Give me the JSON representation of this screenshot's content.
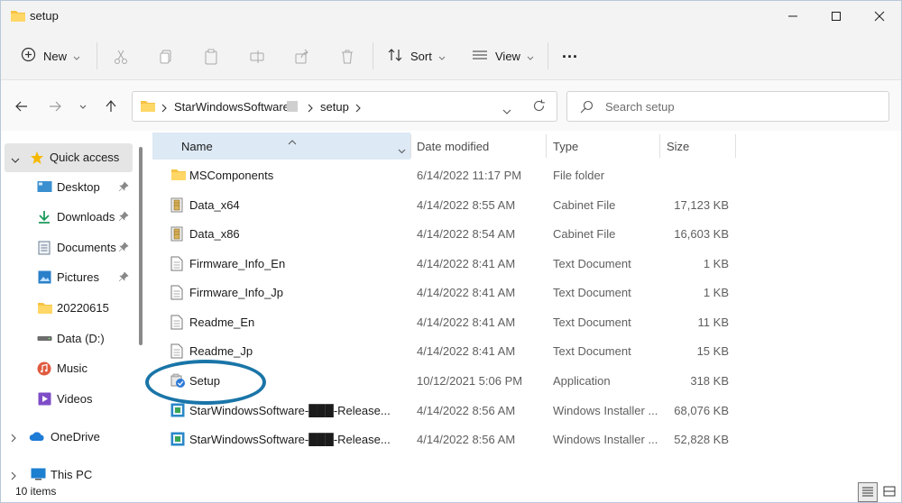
{
  "window": {
    "title": "setup"
  },
  "toolbar": {
    "new_label": "New",
    "sort_label": "Sort",
    "view_label": "View",
    "more_label": "..."
  },
  "address": {
    "segments": [
      "StarWindowsSoftware",
      "setup"
    ],
    "search_placeholder": "Search setup"
  },
  "nav": {
    "items": [
      {
        "label": "Quick access",
        "icon": "star-icon"
      },
      {
        "label": "Desktop",
        "icon": "desktop-icon",
        "pinned": true
      },
      {
        "label": "Downloads",
        "icon": "download-icon",
        "pinned": true
      },
      {
        "label": "Documents",
        "icon": "document-icon",
        "pinned": true
      },
      {
        "label": "Pictures",
        "icon": "picture-icon",
        "pinned": true
      },
      {
        "label": "20220615",
        "icon": "folder-icon"
      },
      {
        "label": "Data (D:)",
        "icon": "drive-icon"
      },
      {
        "label": "Music",
        "icon": "music-icon"
      },
      {
        "label": "Videos",
        "icon": "video-icon"
      },
      {
        "label": "OneDrive",
        "icon": "cloud-icon"
      },
      {
        "label": "This PC",
        "icon": "computer-icon"
      }
    ]
  },
  "columns": {
    "name": "Name",
    "date": "Date modified",
    "type": "Type",
    "size": "Size"
  },
  "files": [
    {
      "name": "MSComponents",
      "date": "6/14/2022 11:17 PM",
      "type": "File folder",
      "size": "",
      "icon": "folder-icon"
    },
    {
      "name": "Data_x64",
      "date": "4/14/2022 8:55 AM",
      "type": "Cabinet File",
      "size": "17,123 KB",
      "icon": "cabinet-icon"
    },
    {
      "name": "Data_x86",
      "date": "4/14/2022 8:54 AM",
      "type": "Cabinet File",
      "size": "16,603 KB",
      "icon": "cabinet-icon"
    },
    {
      "name": "Firmware_Info_En",
      "date": "4/14/2022 8:41 AM",
      "type": "Text Document",
      "size": "1 KB",
      "icon": "text-file-icon"
    },
    {
      "name": "Firmware_Info_Jp",
      "date": "4/14/2022 8:41 AM",
      "type": "Text Document",
      "size": "1 KB",
      "icon": "text-file-icon"
    },
    {
      "name": "Readme_En",
      "date": "4/14/2022 8:41 AM",
      "type": "Text Document",
      "size": "11 KB",
      "icon": "text-file-icon"
    },
    {
      "name": "Readme_Jp",
      "date": "4/14/2022 8:41 AM",
      "type": "Text Document",
      "size": "15 KB",
      "icon": "text-file-icon"
    },
    {
      "name": "Setup",
      "date": "10/12/2021 5:06 PM",
      "type": "Application",
      "size": "318 KB",
      "icon": "setup-app-icon"
    },
    {
      "name": "StarWindowsSoftware-███-Release...",
      "date": "4/14/2022 8:56 AM",
      "type": "Windows Installer ...",
      "size": "68,076 KB",
      "icon": "installer-icon"
    },
    {
      "name": "StarWindowsSoftware-███-Release...",
      "date": "4/14/2022 8:56 AM",
      "type": "Windows Installer ...",
      "size": "52,828 KB",
      "icon": "installer-icon"
    }
  ],
  "status": {
    "item_count": "10 items"
  },
  "colors": {
    "accent": "#0067c0",
    "selection": "#dde9f5",
    "annotation_ring": "#1a75a8"
  }
}
